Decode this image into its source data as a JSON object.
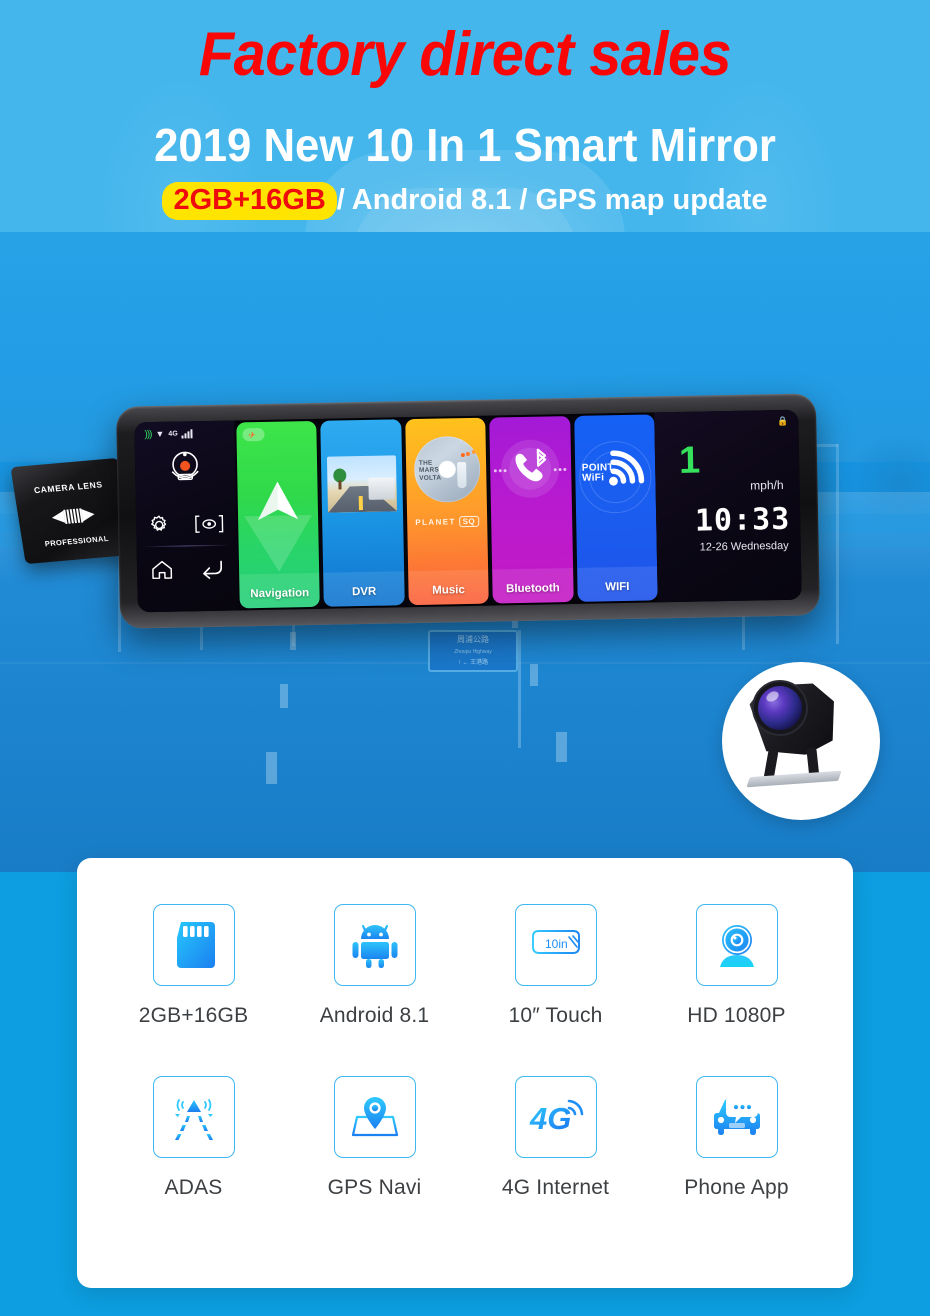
{
  "header": {
    "headline": "Factory direct sales",
    "subheadline": "2019 New 10 In 1 Smart Mirror",
    "spec_badge": "2GB+16GB",
    "spec_rest": "/ Android 8.1 / GPS map update",
    "headline_color": "#f90606",
    "badge_bg": "#ffe400",
    "badge_color": "#ef0b0b",
    "band_color": "#44b6ec"
  },
  "device": {
    "statusbar": {
      "gps_icon": "gps-signal-icon",
      "wifi_icon": "wifi-icon",
      "network_label": "4G",
      "signal_icon": "signal-bars-icon"
    },
    "controls": [
      {
        "name": "camera-icon",
        "label": "Camera"
      },
      {
        "name": "gear-icon",
        "label": "Settings"
      },
      {
        "name": "eye-bracket-icon",
        "label": "Preview"
      },
      {
        "name": "home-icon",
        "label": "Home"
      },
      {
        "name": "back-arrow-icon",
        "label": "Back"
      }
    ],
    "tiles": [
      {
        "label": "Navigation",
        "icon": "navigation-arrow-icon",
        "color": "#2fd94a"
      },
      {
        "label": "DVR",
        "icon": "dashcam-photo-icon",
        "color": "#1c9ae8"
      },
      {
        "label": "Music",
        "icon": "album-disc-icon",
        "color": "#ff9d2a",
        "album_artist": "THE MARS VOLTA",
        "album_line1": "THE",
        "album_line2": "MARS",
        "album_line3": "VOLTA",
        "album_caption": "PLANET",
        "album_tag": "SQ"
      },
      {
        "label": "Bluetooth",
        "icon": "bluetooth-phone-icon",
        "color": "#b81ad0"
      },
      {
        "label": "WIFI",
        "icon": "wifi-point-icon",
        "color": "#1a5ef0",
        "logo_line1": "POINT",
        "logo_line2": "WiFi"
      }
    ],
    "hud": {
      "lock_icon": "lock-icon",
      "speed": "1",
      "speed_unit": "mph/h",
      "clock": "10:33",
      "date": "12-26 Wednesday",
      "speed_color": "#34e05c"
    }
  },
  "lens_accessory": {
    "top_text": "CAMERA LENS",
    "bottom_text": "PROFESSIONAL",
    "arrows_icon": "double-arrow-icon"
  },
  "rear_camera": {
    "icon": "rear-camera-product-photo"
  },
  "road_sign": {
    "line1": "周浦公路",
    "line2": "Zhoupu Highway",
    "line3": "↑   ←  王港路"
  },
  "features": [
    {
      "label": "2GB+16GB",
      "icon": "sd-card-icon"
    },
    {
      "label": "Android 8.1",
      "icon": "android-robot-icon"
    },
    {
      "label": "10″ Touch",
      "icon": "mirror-screen-icon",
      "inner_text": "10in"
    },
    {
      "label": "HD 1080P",
      "icon": "camera-lens-icon"
    },
    {
      "label": "ADAS",
      "icon": "adas-lane-icon"
    },
    {
      "label": "GPS Navi",
      "icon": "map-pin-icon"
    },
    {
      "label": "4G Internet",
      "icon": "4g-signal-icon",
      "inner_text": "4G"
    },
    {
      "label": "Phone App",
      "icon": "car-chat-icon"
    }
  ],
  "colors": {
    "page_bg": "#0c9ee0",
    "accent_blue": "#3fb7f0",
    "icon_gradient_start": "#25c6fb",
    "icon_gradient_end": "#1b7ff0",
    "card_bg": "#ffffff",
    "label_text": "#3d4043"
  }
}
